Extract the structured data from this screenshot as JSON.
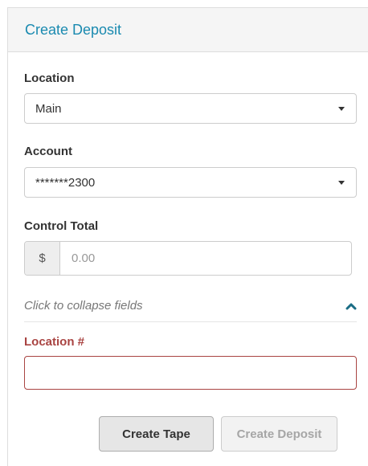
{
  "panel": {
    "title": "Create Deposit"
  },
  "form": {
    "location": {
      "label": "Location",
      "value": "Main"
    },
    "account": {
      "label": "Account",
      "value": "*******2300"
    },
    "control_total": {
      "label": "Control Total",
      "addon": "$",
      "placeholder": "0.00"
    },
    "collapse": {
      "text": "Click to collapse fields",
      "icon": "chevron-up-icon"
    },
    "location_number": {
      "label": "Location #",
      "value": ""
    }
  },
  "buttons": {
    "create_tape": "Create Tape",
    "create_deposit": "Create Deposit"
  },
  "colors": {
    "title": "#1a8ab0",
    "error": "#a94442",
    "chevron": "#1b6d85"
  }
}
